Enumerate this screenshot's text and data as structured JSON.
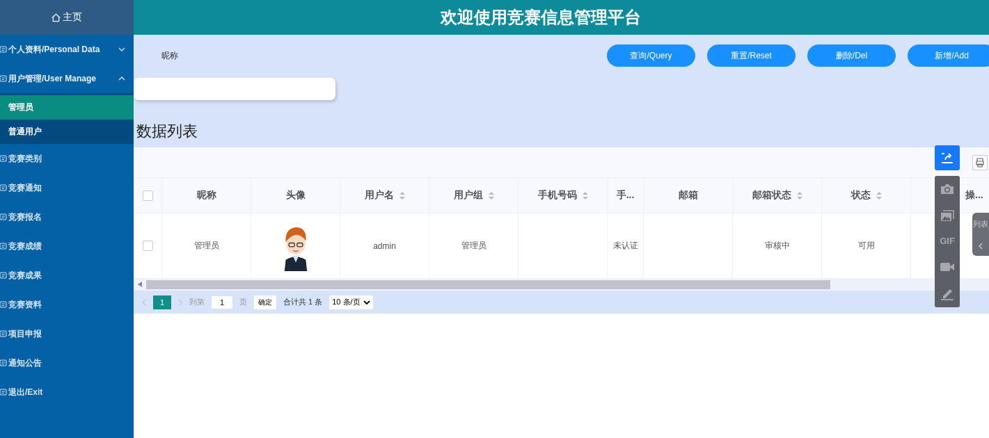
{
  "sidebar": {
    "home": "主页",
    "items": [
      {
        "kind": "group",
        "label": "个人资料/Personal Data",
        "expanded": false
      },
      {
        "kind": "group",
        "label": "用户管理/User Manage",
        "expanded": true,
        "children": [
          {
            "label": "管理员",
            "selected": true
          },
          {
            "label": "普通用户",
            "selected": false
          }
        ]
      },
      {
        "kind": "item",
        "label": "竞赛类别"
      },
      {
        "kind": "item",
        "label": "竞赛通知"
      },
      {
        "kind": "item",
        "label": "竞赛报名"
      },
      {
        "kind": "item",
        "label": "竞赛成绩"
      },
      {
        "kind": "item",
        "label": "竞赛成果"
      },
      {
        "kind": "item",
        "label": "竞赛资料"
      },
      {
        "kind": "item",
        "label": "项目申报"
      },
      {
        "kind": "item",
        "label": "通知公告"
      },
      {
        "kind": "item",
        "label": "退出/Exit"
      }
    ]
  },
  "header": {
    "title": "欢迎使用竞赛信息管理平台"
  },
  "search": {
    "label": "昵称",
    "buttons": [
      "查询/Query",
      "重置/Reset",
      "删除/Del",
      "新增/Add"
    ]
  },
  "list_title": "数据列表",
  "table": {
    "header_checked": false,
    "columns": [
      {
        "label": "昵称",
        "sortable": false
      },
      {
        "label": "头像",
        "sortable": false
      },
      {
        "label": "用户名",
        "sortable": true
      },
      {
        "label": "用户组",
        "sortable": true
      },
      {
        "label": "手机号码",
        "sortable": true
      },
      {
        "label": "手...",
        "sortable": false
      },
      {
        "label": "邮箱",
        "sortable": false
      },
      {
        "label": "邮箱状态",
        "sortable": true
      },
      {
        "label": "状态",
        "sortable": true
      },
      {
        "label": "操..."
      }
    ],
    "rows": [
      {
        "checked": false,
        "cells": [
          {
            "kind": "text",
            "text": "管理员"
          },
          {
            "kind": "avatar"
          },
          {
            "kind": "text",
            "text": "admin"
          },
          {
            "kind": "text",
            "text": "管理员"
          },
          {
            "kind": "empty"
          },
          {
            "kind": "text",
            "text": "未认证"
          },
          {
            "kind": "empty"
          },
          {
            "kind": "text",
            "text": "审核中"
          },
          {
            "kind": "text",
            "text": "可用"
          },
          {
            "kind": "empty"
          }
        ]
      }
    ]
  },
  "pagination": {
    "pages": [
      {
        "label": "1",
        "selected": true
      }
    ],
    "goto_label": "到第",
    "goto_value": "1",
    "page_unit": "页",
    "confirm": "确定",
    "total": "合计共 1 条",
    "page_size": "10 条/页"
  },
  "capture_toolbar": {
    "gif_label": "GIF"
  },
  "side_tab": {
    "label": "列表"
  }
}
